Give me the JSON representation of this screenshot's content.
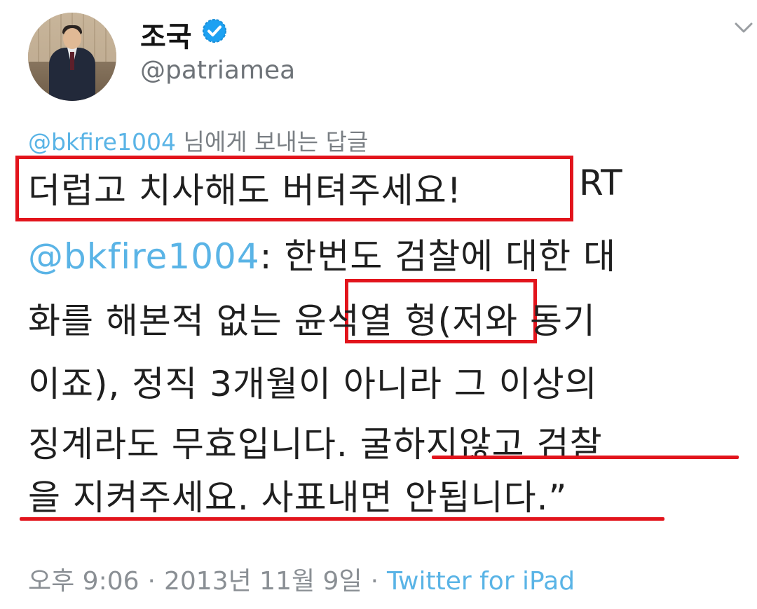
{
  "tweet": {
    "name": "조국",
    "handle": "@patriamea",
    "reply": {
      "mention": "@bkfire1004",
      "suffix": " 님에게 보내는 답글"
    },
    "body": {
      "line1_highlight": "더럽고 치사해도 버텨주세요!",
      "line1_rt": "RT",
      "line2_mention": "@bkfire1004",
      "line2_rest": ": 한번도 검찰에 대한 대",
      "line3_pre": "화를 해본적 없는 ",
      "line3_highlight": "윤석열 형",
      "line3_post": "(저와 동기",
      "line4": "이죠), 정직 3개월이 아니라 그 이상의",
      "line5_pre": "징계라도 무효입니다. ",
      "line5_underlined": "굴하지않고 검찰",
      "line6": "을 지켜주세요. 사표내면 안됩니다.”"
    },
    "meta": {
      "time": "오후 9:06",
      "separator": "·",
      "date": "2013년 11월 9일",
      "source": "Twitter for iPad"
    },
    "icons": {
      "verified": "verified-badge-icon",
      "more": "chevron-down-icon",
      "avatar": "profile-photo"
    },
    "colors": {
      "highlight_red": "#e2141c",
      "link_blue": "#5ab4e6",
      "verified_blue": "#1da1f2"
    }
  }
}
